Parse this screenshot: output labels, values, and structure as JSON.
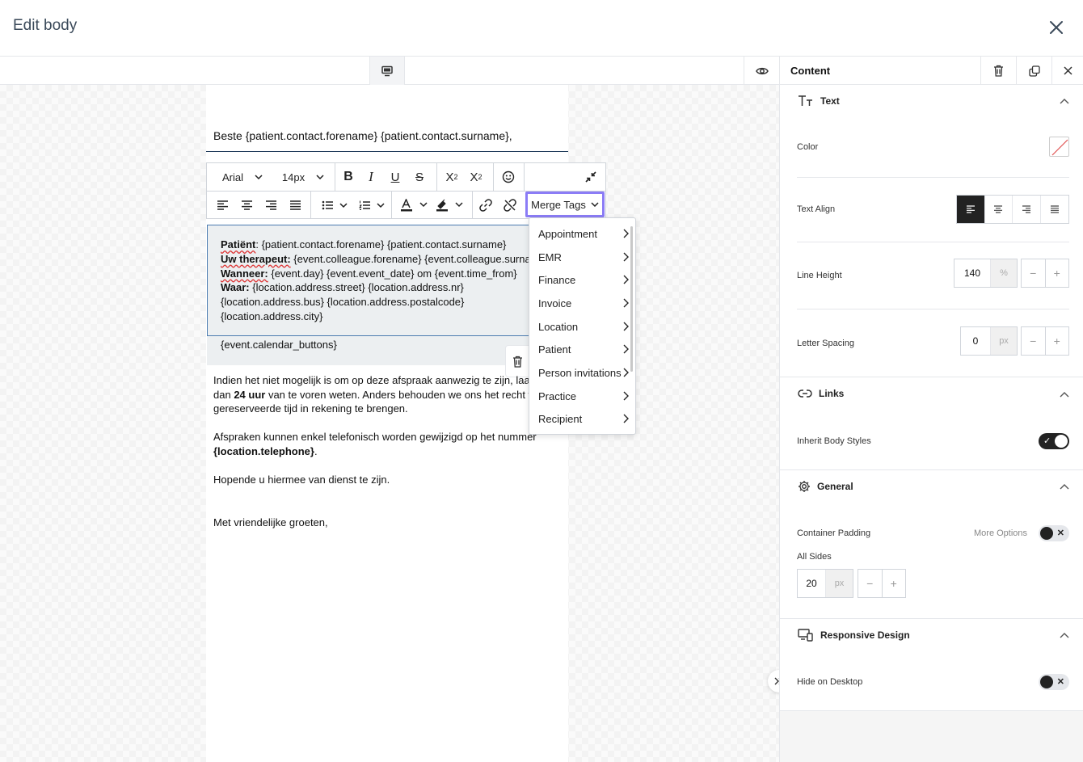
{
  "header": {
    "title": "Edit body"
  },
  "editor": {
    "greeting": "Beste {patient.contact.forename} {patient.contact.surname},",
    "toolbar": {
      "font": "Arial",
      "size": "14px",
      "merge_tags_label": "Merge Tags"
    },
    "block": {
      "lines": [
        {
          "label": "Patiënt",
          "sep": ":",
          "value": " {patient.contact.forename} {patient.contact.surname}"
        },
        {
          "label": "Uw therapeut:",
          "sep": "",
          "value": " {event.colleague.forename} {event.colleague.surnam"
        },
        {
          "label": "Wanneer:",
          "sep": "",
          "value": " {event.day} {event.event_date} om {event.time_from}"
        },
        {
          "label": "Waar:",
          "sep": "",
          "value": " {location.address.street} {location.address.nr}"
        }
      ],
      "line5": "{location.address.bus} {location.address.postalcode}",
      "line6": "{location.address.city}",
      "calendar": "{event.calendar_buttons}"
    },
    "para1": {
      "l1": "Indien het niet mogelijk is om op deze afspraak aanwezig te zijn, laat d",
      "l2a": "dan ",
      "l2b": "24 uur",
      "l2c": " van te voren weten. Anders behouden we ons het recht vo",
      "l3": "gereserveerde tijd in rekening te brengen."
    },
    "para2": {
      "l1": "Afspraken kunnen enkel telefonisch worden gewijzigd op het nummer",
      "l2": "{location.telephone}",
      "l2end": "."
    },
    "para3": "Hopende u hiermee van dienst te zijn.",
    "para4": "Met vriendelijke groeten,"
  },
  "merge_menu": {
    "items": [
      "Appointment",
      "EMR",
      "Finance",
      "Invoice",
      "Location",
      "Patient",
      "Person invitations",
      "Practice",
      "Recipient"
    ]
  },
  "panel": {
    "title": "Content",
    "text_section": {
      "title": "Text",
      "color_label": "Color",
      "align_label": "Text Align",
      "line_height_label": "Line Height",
      "line_height_value": "140",
      "line_height_unit": "%",
      "letter_spacing_label": "Letter Spacing",
      "letter_spacing_value": "0",
      "letter_spacing_unit": "px",
      "active_alignment": "left"
    },
    "links_section": {
      "title": "Links",
      "inherit_label": "Inherit Body Styles",
      "inherit_on": true
    },
    "general_section": {
      "title": "General",
      "padding_label": "Container Padding",
      "more_options": "More Options",
      "all_sides": "All Sides",
      "padding_value": "20",
      "padding_unit": "px"
    },
    "responsive_section": {
      "title": "Responsive Design",
      "hide_desktop": "Hide on Desktop"
    }
  }
}
